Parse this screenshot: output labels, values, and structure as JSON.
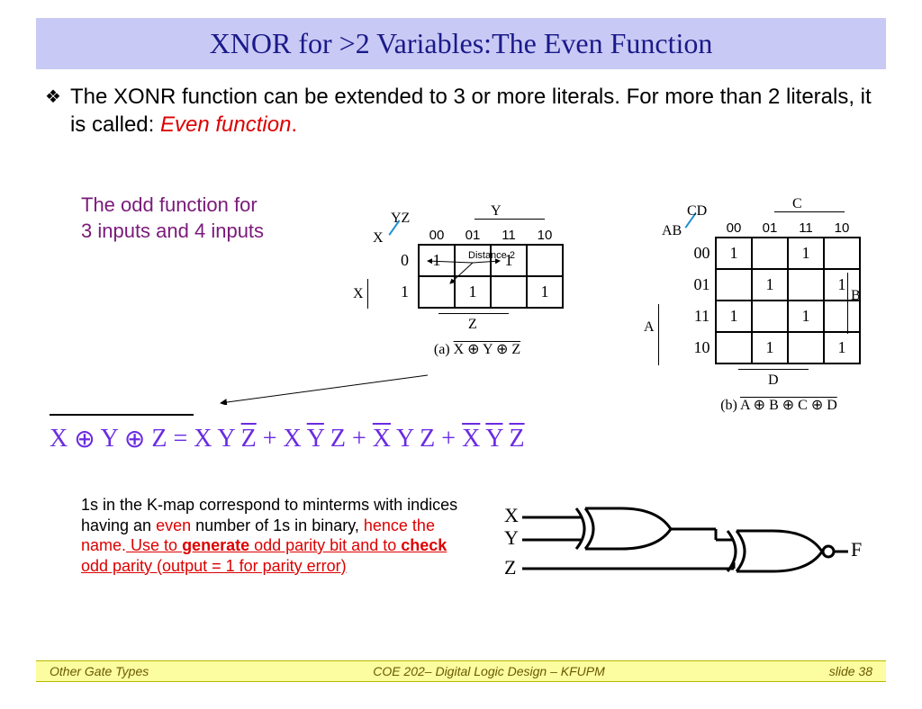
{
  "title": "XNOR for >2 Variables:The Even Function",
  "bullet": {
    "prefix": "The XONR function can be extended to 3 or more literals. For more than 2 literals, it is called: ",
    "em": "Even function",
    "suffix": "."
  },
  "purple_note": {
    "l1": "The odd function for",
    "l2": "3 inputs and 4 inputs"
  },
  "equation": {
    "lhs": "X ⊕ Y ⊕ Z",
    "eq": " = ",
    "t1": "X Y Z̄",
    "t2": "X Ȳ Z",
    "t3": "X̄ Y Z",
    "t4": "X̄ Ȳ Z̄",
    "plus": " + "
  },
  "kmap3": {
    "corner": "X",
    "cols_var": "YZ",
    "col_headers": [
      "00",
      "01",
      "11",
      "10"
    ],
    "row_headers": [
      "0",
      "1"
    ],
    "top_var": "Y",
    "left_var": "X",
    "bottom_var": "Z",
    "cells": [
      [
        "1",
        "",
        "1",
        ""
      ],
      [
        "",
        "1",
        "",
        "1"
      ]
    ],
    "caption_a": "(a)",
    "caption_expr": "X ⊕ Y ⊕ Z",
    "distance": "Distance 2"
  },
  "kmap4": {
    "corner": "AB",
    "cols_var": "CD",
    "col_headers": [
      "00",
      "01",
      "11",
      "10"
    ],
    "row_headers": [
      "00",
      "01",
      "11",
      "10"
    ],
    "top_var": "C",
    "left_var": "A",
    "right_var": "B",
    "bottom_var": "D",
    "cells": [
      [
        "1",
        "",
        "1",
        ""
      ],
      [
        "",
        "1",
        "",
        "1"
      ],
      [
        "1",
        "",
        "1",
        ""
      ],
      [
        "",
        "1",
        "",
        "1"
      ]
    ],
    "caption_b": "(b)",
    "caption_expr": "A ⊕ B ⊕ C ⊕ D"
  },
  "bottom": {
    "p1a": "1s in the K-map correspond to minterms with indices having an ",
    "even": "even",
    "p1b": " number of 1s in binary, ",
    "hence": "hence the name.",
    "use_to": " Use to ",
    "gen": "generate",
    "odd1": " odd",
    "parity1": " parity bit and to ",
    "check": "check",
    "odd2": " odd parity (output = 1 for parity error)"
  },
  "circuit": {
    "inputs": [
      "X",
      "Y",
      "Z"
    ],
    "output": "F"
  },
  "footer": {
    "left": "Other Gate Types",
    "center": "COE 202– Digital Logic  Design – KFUPM",
    "right": "slide 38"
  }
}
